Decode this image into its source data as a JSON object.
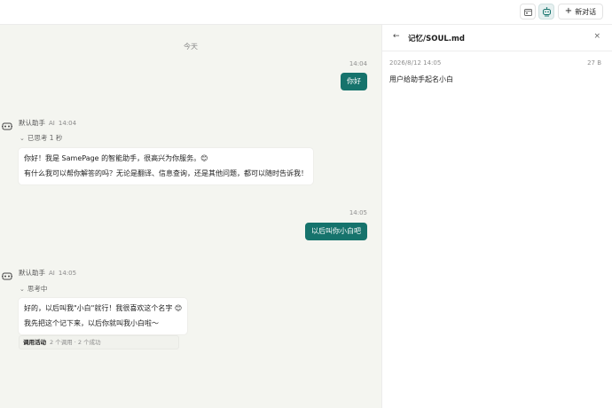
{
  "header": {
    "new_chat_label": "新对话",
    "icons": [
      "calendar-icon",
      "robot-icon",
      "plus-icon"
    ]
  },
  "chat": {
    "day_separator": "今天",
    "messages": [
      {
        "role": "user",
        "time": "14:04",
        "text": "你好"
      },
      {
        "role": "assistant",
        "name": "默认助手",
        "badge": "AI",
        "time": "14:04",
        "thinking": "已思考 1 秒",
        "lines": [
          "你好！我是 SamePage 的智能助手，很高兴为你服务。😊",
          "有什么我可以帮你解答的吗？无论是翻译、信息查询，还是其他问题，都可以随时告诉我！"
        ]
      },
      {
        "role": "user",
        "time": "14:05",
        "text": "以后叫你小白吧"
      },
      {
        "role": "assistant",
        "name": "默认助手",
        "badge": "AI",
        "time": "14:05",
        "thinking": "思考中",
        "lines": [
          "好的，以后叫我\"小白\"就行！我很喜欢这个名字 😊",
          "我先把这个记下来，以后你就叫我小白啦～"
        ],
        "activity": {
          "label": "调用活动",
          "stats": "2 个调用 · 2 个成功"
        }
      }
    ]
  },
  "panel": {
    "title": "记忆/SOUL.md",
    "date": "2026/8/12 14:05",
    "size": "27 B",
    "content": "用户给助手起名小白"
  },
  "colors": {
    "accent": "#16736c",
    "chat_bg": "#f4f5f0"
  }
}
